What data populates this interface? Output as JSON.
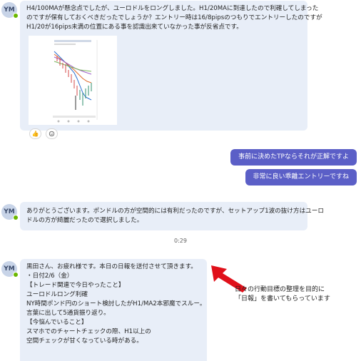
{
  "messages": [
    {
      "sender_initials": "YM",
      "lines": [
        "H4/100MAが懸念点でしたが、ユーロドルをロングしました。H1/20MAに到達したので利確してしまった",
        "のですが保有しておくべきだったでしょうか？エントリー時は16/8pipsのつもりでエントリーしたのですが",
        "H1/20が16pips未満の位置にある事を認識出来ていなかった事が反省点です。"
      ],
      "reactions": [
        "👍",
        "+😊"
      ]
    },
    {
      "sender_initials": "YM",
      "lines": [
        "ありがとうございます。ポンドルの方が空間的には有利だったのですが、セットアップ1波の抜け方はユーロ",
        "ドルの方が綺麗だったので選択しました。"
      ]
    },
    {
      "sender_initials": "YM",
      "lines": [
        "黒田さん、お疲れ様です。本日の日報を送付させて頂きます。",
        "・日付2/6（金）",
        "【トレード関連で今日やったこと】",
        "ユーロドルロング利確",
        "NY時間ポンド円のショート検討したがH1/MA2本邪魔でスルー。",
        "言葉に出して5通貨振り返り。",
        "【今悩んでいること】",
        "スマホでのチャートチェックの際、H1以上の",
        "空間チェックが甘くなっている時がある。"
      ]
    }
  ],
  "replies": [
    "事前に決めたTPならそれが正解ですよ",
    "非常に良い乖離エントリーですね"
  ],
  "timestamp": "0:29",
  "annotation": [
    "日々の行動目標の整理を目的に",
    "「日報」を書いてもらっています"
  ],
  "colors": {
    "incoming_bubble": "#e8eef8",
    "outgoing_bubble": "#5b5fc7",
    "presence": "#6bb700",
    "arrow": "#e0101a"
  },
  "icons": {
    "presence": "presence-available-icon",
    "like": "thumbs-up-icon",
    "add_reaction": "add-reaction-icon",
    "arrow": "red-arrow-icon"
  }
}
